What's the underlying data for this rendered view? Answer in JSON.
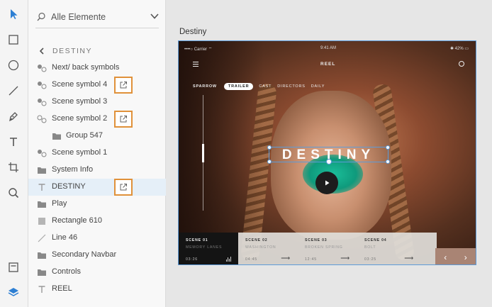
{
  "toolbar": {
    "tools": [
      "select-tool",
      "rectangle-tool",
      "ellipse-tool",
      "line-tool",
      "pen-tool",
      "text-tool",
      "artboard-tool",
      "zoom-tool"
    ],
    "bottom": [
      "assets-panel",
      "layers-panel"
    ],
    "accent": "#2d7fd3"
  },
  "layers": {
    "search_text": "Alle Elemente",
    "breadcrumb": "DESTINY",
    "items": [
      {
        "label": "Next/ back symbols",
        "icon": "symbol-icon"
      },
      {
        "label": "Scene symbol 4",
        "icon": "symbol-icon",
        "external": true
      },
      {
        "label": "Scene symbol 3",
        "icon": "symbol-icon"
      },
      {
        "label": "Scene symbol 2",
        "icon": "symbol-icon",
        "external": true
      },
      {
        "label": "Group 547",
        "icon": "folder-icon"
      },
      {
        "label": "Scene symbol 1",
        "icon": "symbol-icon"
      },
      {
        "label": "System Info",
        "icon": "folder-icon"
      },
      {
        "label": "DESTINY",
        "icon": "text-icon",
        "external": true,
        "selected": true
      },
      {
        "label": "Play",
        "icon": "folder-icon"
      },
      {
        "label": "Rectangle 610",
        "icon": "rectangle-icon"
      },
      {
        "label": "Line 46",
        "icon": "line-icon"
      },
      {
        "label": "Secondary Navbar",
        "icon": "folder-icon"
      },
      {
        "label": "Controls",
        "icon": "folder-icon"
      },
      {
        "label": "REEL",
        "icon": "text-icon"
      }
    ],
    "external_highlight_color": "#e0913a"
  },
  "canvas": {
    "artboard_name": "Destiny",
    "status": {
      "carrier": "••••○ Carrier ⌔",
      "time": "9:41 AM",
      "battery": "✱ 42% ▭"
    },
    "nav_title": "REEL",
    "tabs": {
      "first": "SPARROW",
      "active": "TRAILER",
      "cast": "CAST",
      "directors": "DIRECTORS",
      "extra": "DAILY"
    },
    "hero_title": "DESTINY",
    "scenes": [
      {
        "name": "SCENE 01",
        "sub": "MEMORY LANES",
        "time": "03:26"
      },
      {
        "name": "SCENE 02",
        "sub": "WASHINGTON",
        "time": "04:45"
      },
      {
        "name": "SCENE 03",
        "sub": "BROKEN SPRING",
        "time": "12:45"
      },
      {
        "name": "SCENE 04",
        "sub": "BOLT",
        "time": "03:25"
      }
    ],
    "prev": "‹",
    "next": "›"
  }
}
